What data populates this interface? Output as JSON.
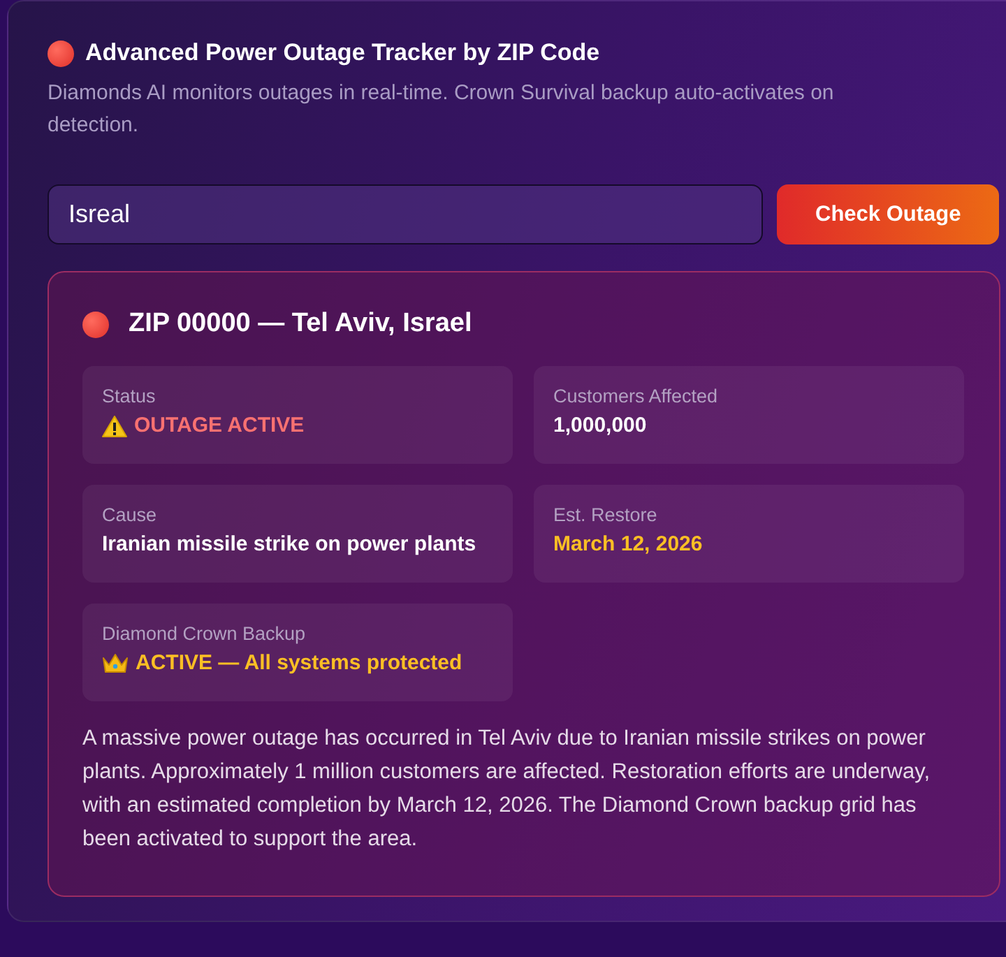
{
  "header": {
    "title": "Advanced Power Outage Tracker by ZIP Code",
    "subtitle": "Diamonds AI monitors outages in real-time. Crown Survival backup auto-activates on detection."
  },
  "search": {
    "value": "Isreal",
    "button": "Check Outage"
  },
  "result": {
    "heading": "ZIP 00000 — Tel Aviv, Israel",
    "fields": [
      {
        "label": "Status",
        "value": "OUTAGE ACTIVE",
        "kind": "alert"
      },
      {
        "label": "Customers Affected",
        "value": "1,000,000",
        "kind": "plain"
      },
      {
        "label": "Cause",
        "value": "Iranian missile strike on power plants",
        "kind": "plain"
      },
      {
        "label": "Est. Restore",
        "value": "March 12, 2026",
        "kind": "date"
      },
      {
        "label": "Diamond Crown Backup",
        "value": "ACTIVE — All systems protected",
        "kind": "backup"
      }
    ],
    "summary": "A massive power outage has occurred in Tel Aviv due to Iranian missile strikes on power plants. Approximately 1 million customers are affected. Restoration efforts are underway, with an estimated completion by March 12, 2026. The Diamond Crown backup grid has been activated to support the area."
  }
}
